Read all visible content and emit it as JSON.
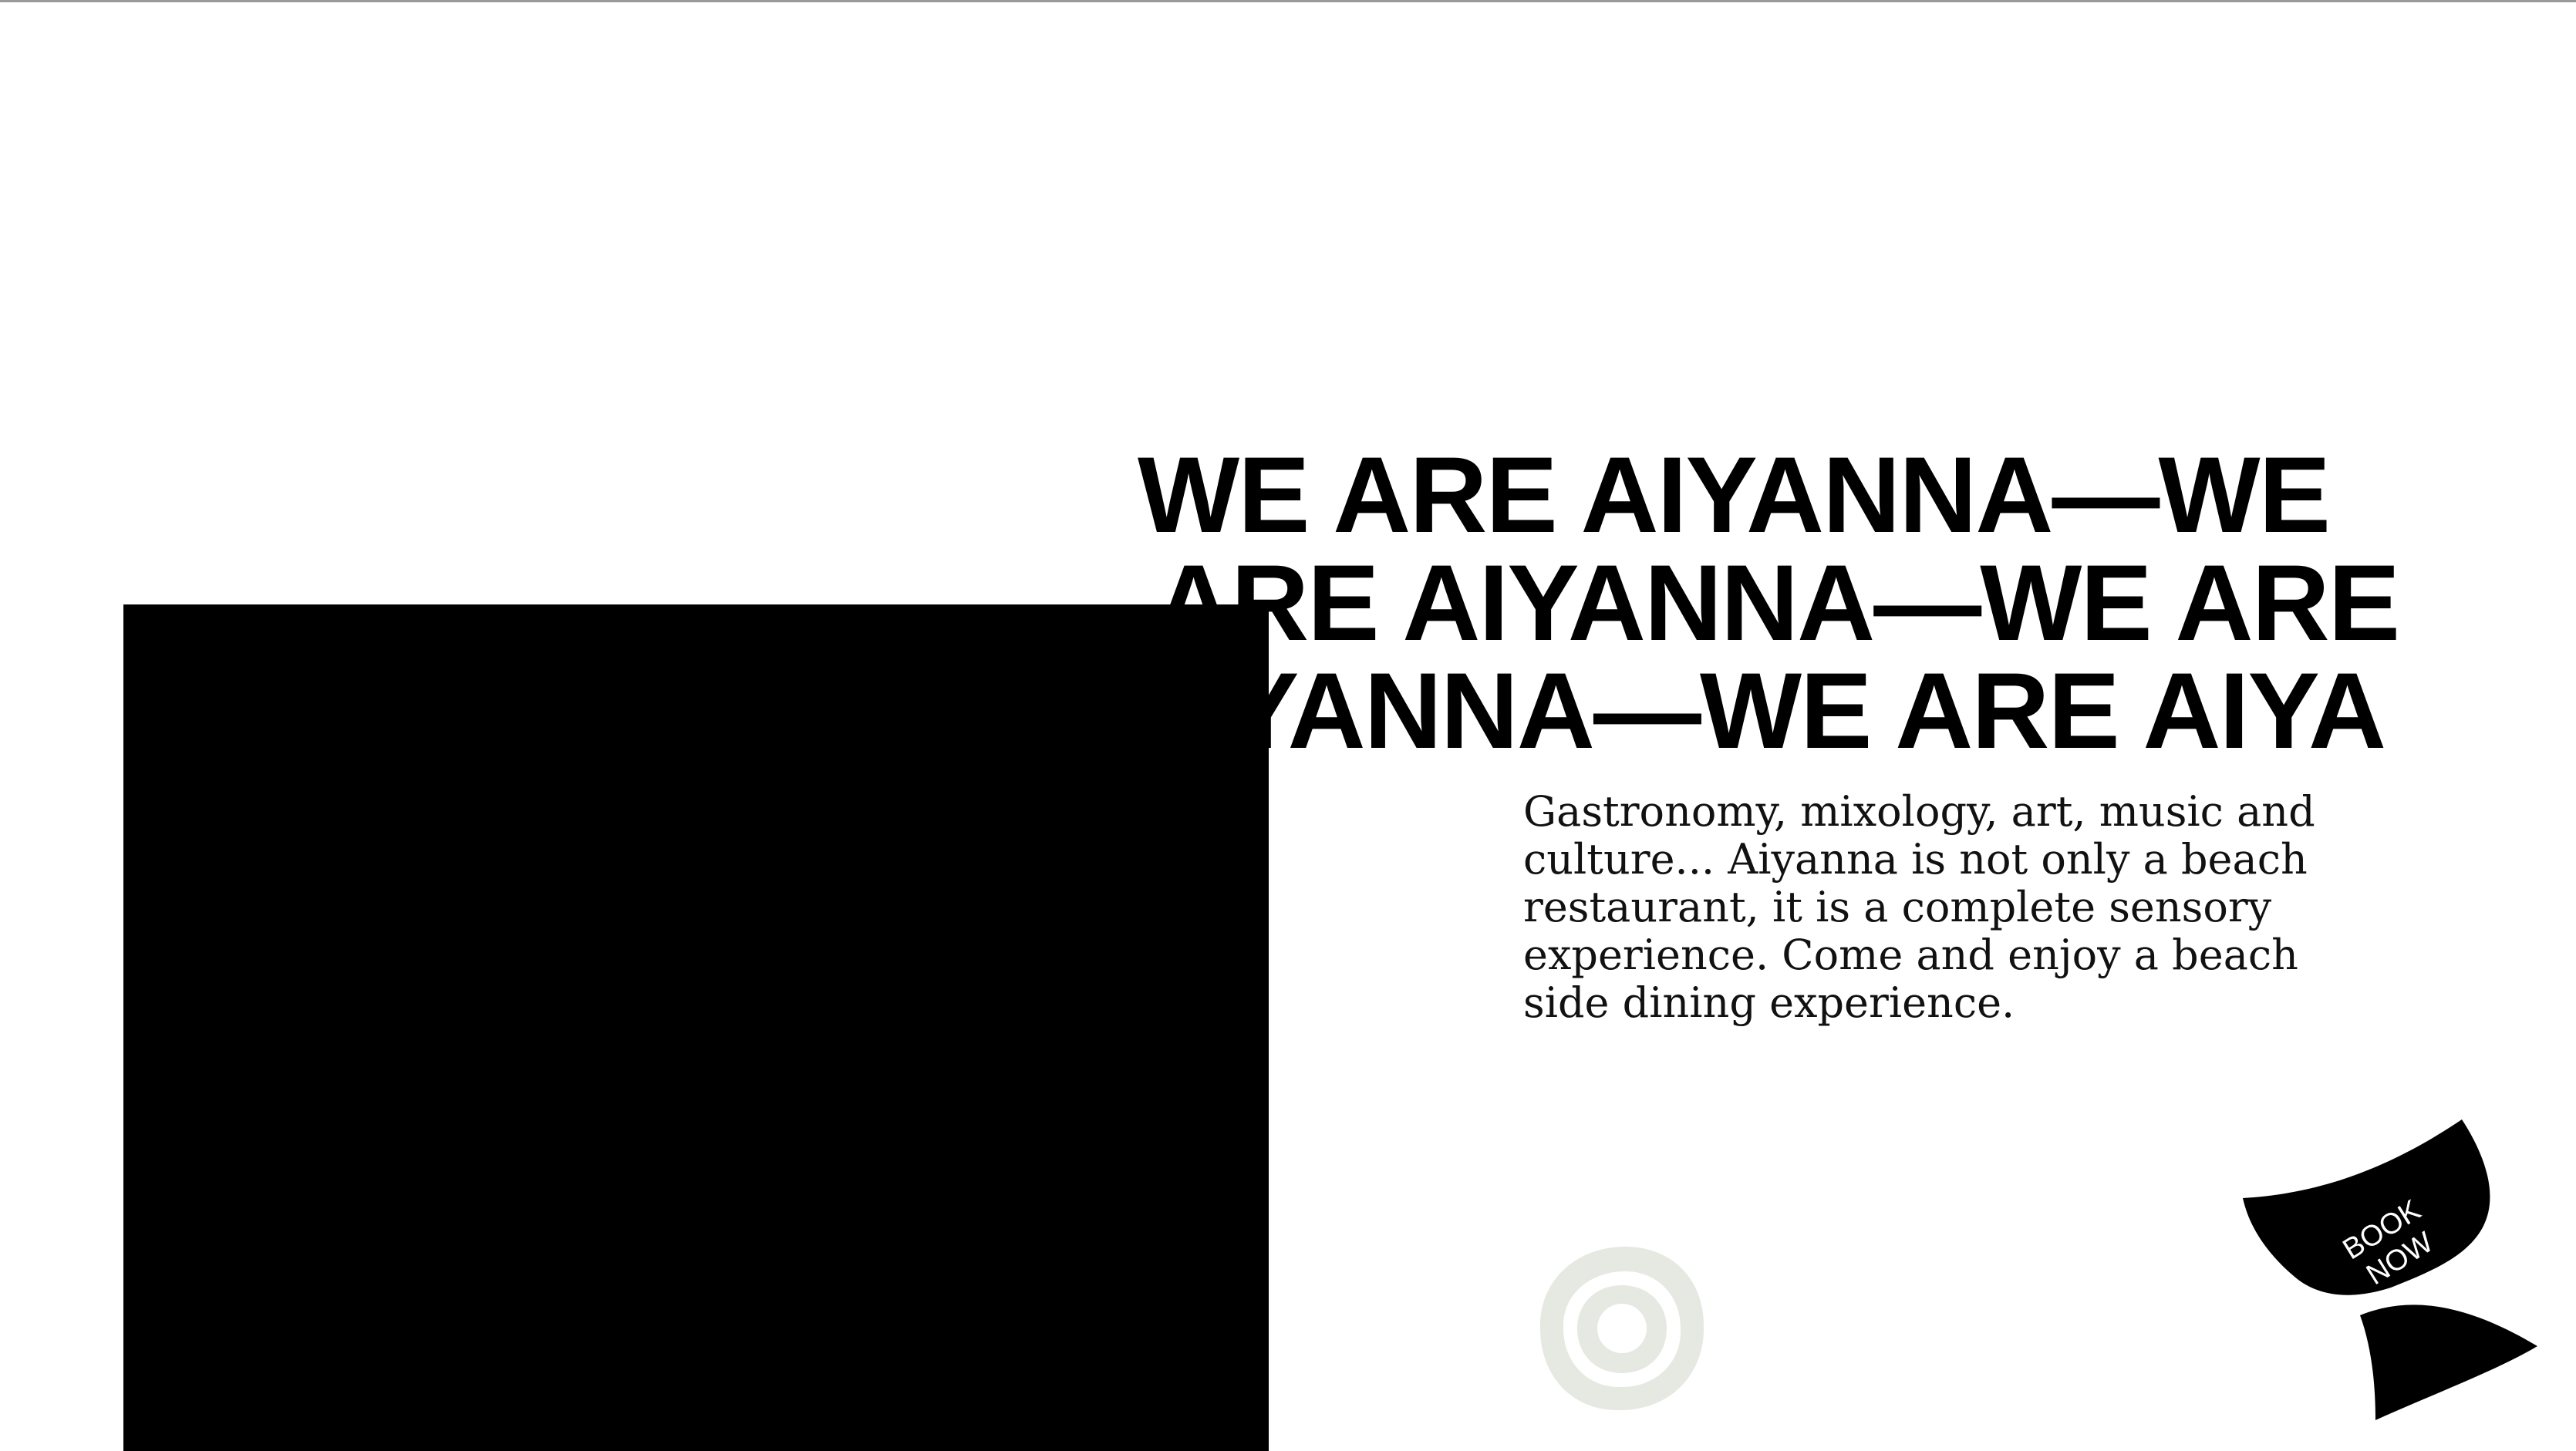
{
  "headline": {
    "line1": "WE ARE AIYANNA—WE",
    "line2": "ARE AIYANNA—WE ARE",
    "line3": "AIYANNA—WE ARE AIYA"
  },
  "intro": {
    "text": "Gastronomy, mixology, art, music and culture... Aiyanna is not only a beach restaurant, it is a complete sensory experience. Come and enjoy a beach side dining experience."
  },
  "cta": {
    "line1": "BOOK",
    "line2": "NOW"
  },
  "colors": {
    "background": "#ffffff",
    "text": "#000000",
    "image_placeholder": "#000000",
    "scroll_indicator": "#e6e9e2"
  },
  "icons": {
    "scroll": "concentric-circle-icon"
  }
}
